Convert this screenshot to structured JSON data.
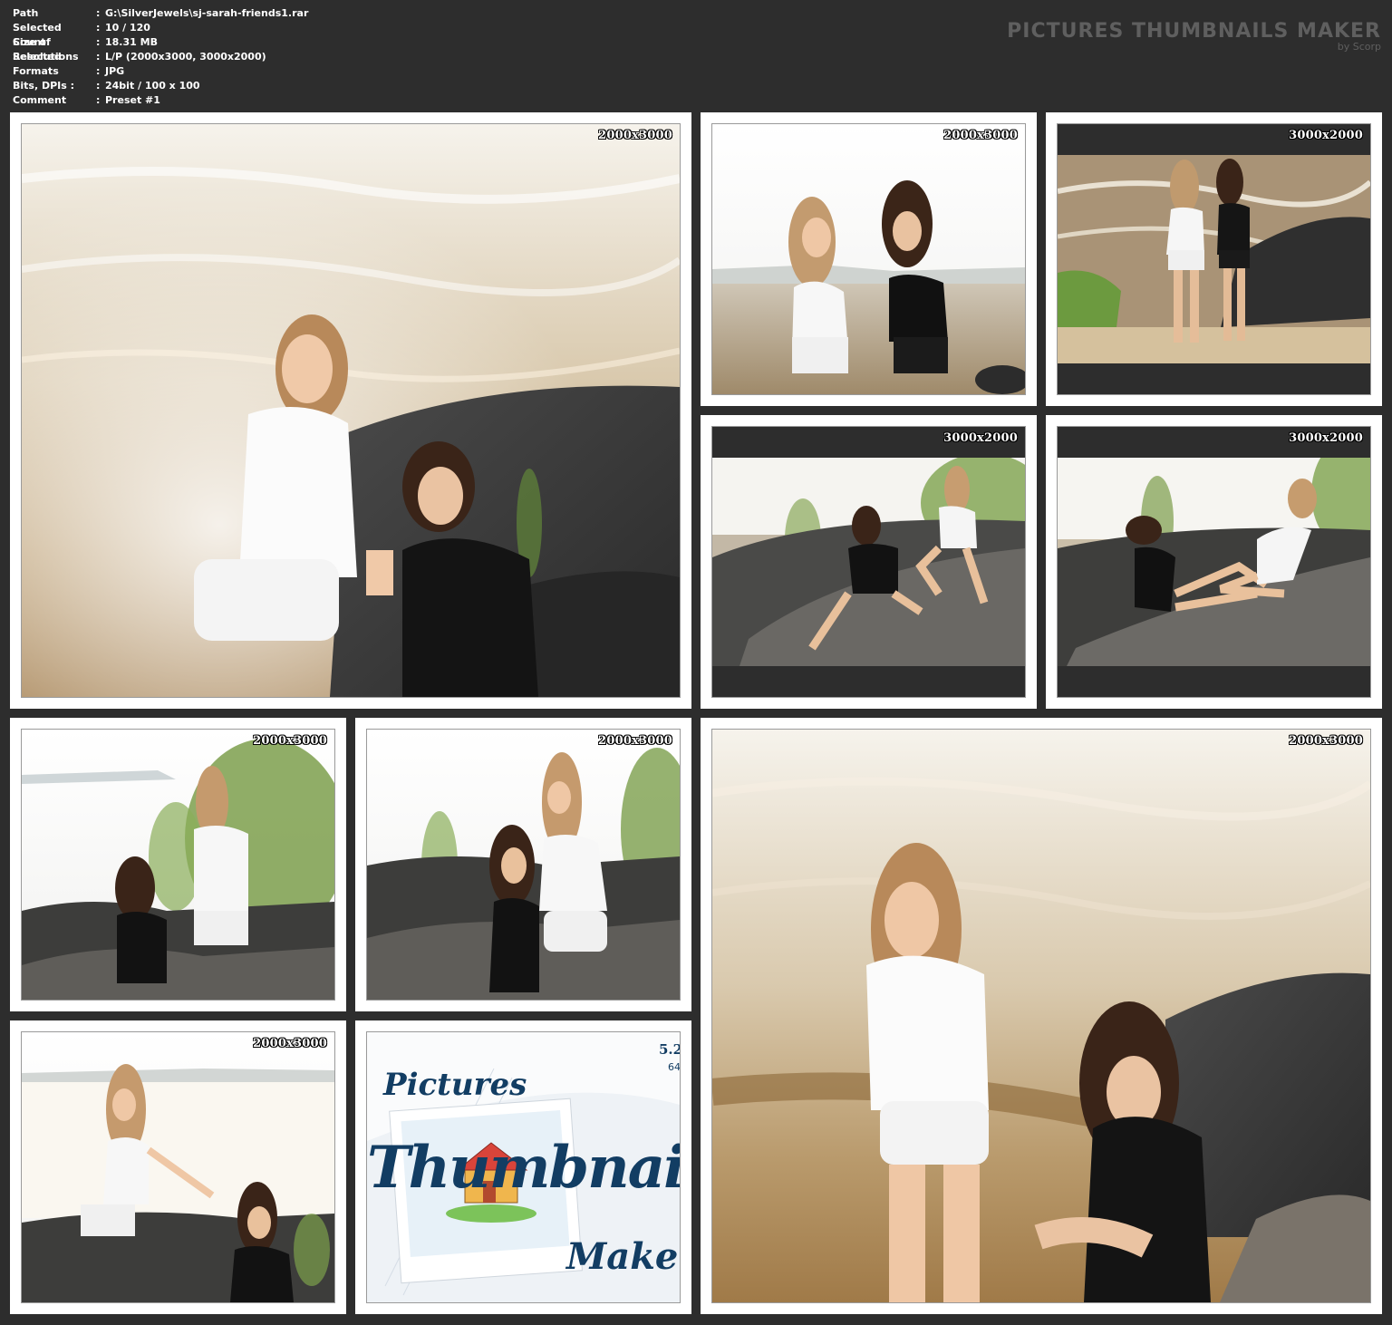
{
  "info": {
    "rows": [
      {
        "key": "Path",
        "sep": ":",
        "value": "G:\\SilverJewels\\sj-sarah-friends1.rar"
      },
      {
        "key": "Selected Count",
        "sep": ":",
        "value": "10 / 120"
      },
      {
        "key": "Size of Selected",
        "sep": ":",
        "value": "18.31 MB"
      },
      {
        "key": "Resolutions",
        "sep": ":",
        "value": "L/P (2000x3000, 3000x2000)"
      },
      {
        "key": "Formats",
        "sep": ":",
        "value": "JPG"
      },
      {
        "key": "Bits, DPIs :",
        "sep": ":",
        "value": "24bit / 100 x 100"
      },
      {
        "key": "Comment",
        "sep": ":",
        "value": "Preset #1"
      }
    ]
  },
  "brand": {
    "title": "PICTURES THUMBNAILS MAKER",
    "subtitle": "by Scorp"
  },
  "thumbnails": [
    {
      "resolution": "2000x3000"
    },
    {
      "resolution": "2000x3000"
    },
    {
      "resolution": "3000x2000"
    },
    {
      "resolution": "3000x2000"
    },
    {
      "resolution": "3000x2000"
    },
    {
      "resolution": "2000x3000"
    },
    {
      "resolution": "2000x3000"
    },
    {
      "resolution": "2000x3000"
    },
    {
      "logo_word1": "Pictures",
      "logo_word2": "Thumbnails",
      "logo_word3": "Maker",
      "version": "5.2",
      "bits": "64"
    },
    {
      "resolution": "2000x3000"
    }
  ],
  "colors": {
    "background": "#2d2d2d",
    "card": "#ffffff",
    "brand_text": "#5f5f5f"
  }
}
